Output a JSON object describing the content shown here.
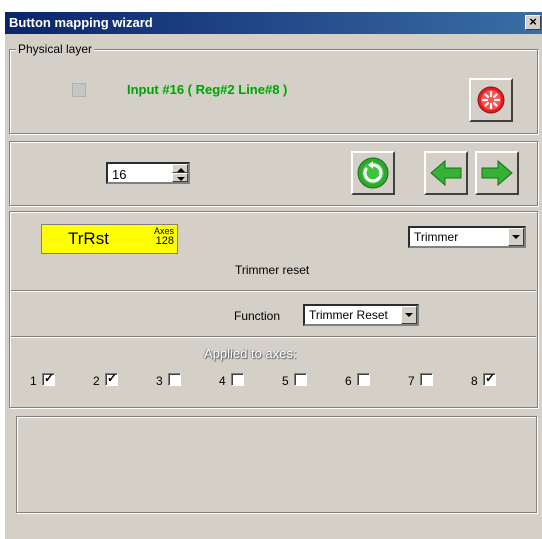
{
  "window": {
    "title": "Button mapping wizard",
    "close_label": "×"
  },
  "physical_layer": {
    "legend": "Physical layer",
    "input_text": "Input #16 ( Reg#2  Line#8 )",
    "reset_icon": "red-burst-icon"
  },
  "navigation": {
    "spin_value": "16",
    "refresh_icon": "green-refresh-icon",
    "prev_icon": "green-left-arrow-icon",
    "next_icon": "green-right-arrow-icon"
  },
  "mapping": {
    "tag_text": "TrRst",
    "tag_axes_label": "Axes",
    "tag_axes_value": "128",
    "type_value": "Trimmer",
    "description": "Trimmer reset",
    "function_label": "Function",
    "function_value": "Trimmer Reset",
    "applied_label": "Applied to axes:",
    "axes": [
      {
        "label": "1",
        "checked": true
      },
      {
        "label": "2",
        "checked": true
      },
      {
        "label": "3",
        "checked": false
      },
      {
        "label": "4",
        "checked": false
      },
      {
        "label": "5",
        "checked": false
      },
      {
        "label": "6",
        "checked": false
      },
      {
        "label": "7",
        "checked": false
      },
      {
        "label": "8",
        "checked": true
      }
    ]
  },
  "colors": {
    "title_bar": "#0a246a",
    "input_text": "#0c9a0c",
    "tag_background": "#ffff00",
    "face": "#d4d0c8"
  }
}
